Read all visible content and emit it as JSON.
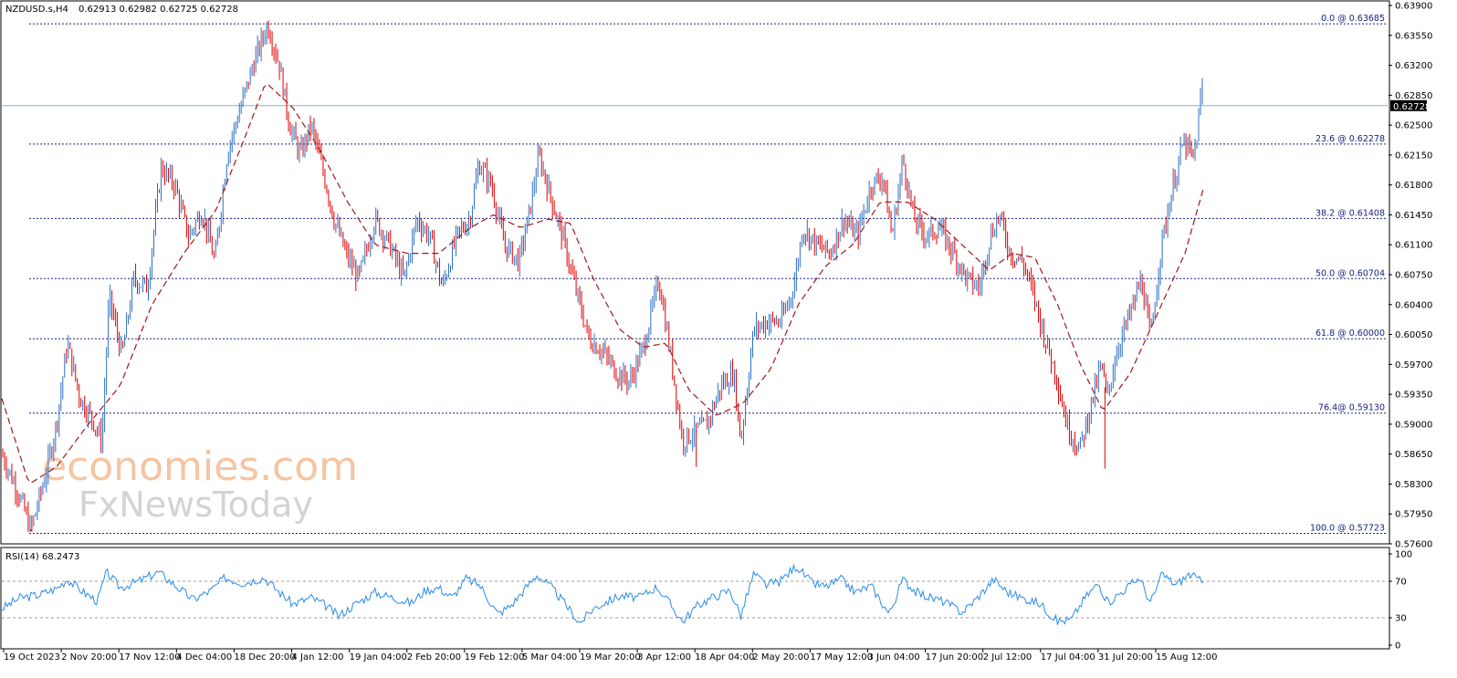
{
  "chart_data": [
    {
      "type": "candlestick",
      "header": {
        "symbol": "NZDUSD.s,H4",
        "ohlc": "0.62913 0.62982 0.62725 0.62728"
      },
      "price_axis": {
        "ticks": [
          "0.63900",
          "0.63550",
          "0.63200",
          "0.62850",
          "0.62500",
          "0.62150",
          "0.61800",
          "0.61450",
          "0.61100",
          "0.60750",
          "0.60400",
          "0.60050",
          "0.59700",
          "0.59350",
          "0.59000",
          "0.58650",
          "0.58300",
          "0.57950",
          "0.57600"
        ],
        "ylim": [
          0.576,
          0.639
        ],
        "current_price_label": "0.62728",
        "current_price": 0.62728
      },
      "time_axis": {
        "labels": [
          "19 Oct 2023",
          "2 Nov 20:00",
          "17 Nov 12:00",
          "4 Dec 04:00",
          "18 Dec 20:00",
          "4 Jan 12:00",
          "19 Jan 04:00",
          "2 Feb 20:00",
          "19 Feb 12:00",
          "5 Mar 04:00",
          "19 Mar 20:00",
          "3 Apr 12:00",
          "18 Apr 04:00",
          "2 May 20:00",
          "17 May 12:00",
          "3 Jun 04:00",
          "17 Jun 20:00",
          "2 Jul 12:00",
          "17 Jul 04:00",
          "31 Jul 20:00",
          "15 Aug 12:00"
        ]
      },
      "fibonacci_levels": [
        {
          "label": "0.0 @ 0.63685",
          "price": 0.63685
        },
        {
          "label": "23.6 @ 0.62278",
          "price": 0.62278
        },
        {
          "label": "38.2 @ 0.61408",
          "price": 0.61408
        },
        {
          "label": "50.0 @ 0.60704",
          "price": 0.60704
        },
        {
          "label": "61.8 @ 0.60000",
          "price": 0.6
        },
        {
          "label": "76.4@ 0.59130",
          "price": 0.5913
        },
        {
          "label": "100.0 @ 0.57723",
          "price": 0.57723
        }
      ],
      "price_path_approx": [
        [
          0,
          0.5865
        ],
        [
          18,
          0.582
        ],
        [
          32,
          0.5777
        ],
        [
          48,
          0.584
        ],
        [
          60,
          0.59
        ],
        [
          72,
          0.5995
        ],
        [
          86,
          0.593
        ],
        [
          100,
          0.5905
        ],
        [
          110,
          0.588
        ],
        [
          118,
          0.605
        ],
        [
          132,
          0.598
        ],
        [
          145,
          0.607
        ],
        [
          160,
          0.606
        ],
        [
          175,
          0.62
        ],
        [
          190,
          0.618
        ],
        [
          205,
          0.612
        ],
        [
          220,
          0.615
        ],
        [
          234,
          0.609
        ],
        [
          248,
          0.622
        ],
        [
          262,
          0.627
        ],
        [
          276,
          0.632
        ],
        [
          292,
          0.6368
        ],
        [
          305,
          0.632
        ],
        [
          316,
          0.625
        ],
        [
          328,
          0.6215
        ],
        [
          340,
          0.625
        ],
        [
          352,
          0.62
        ],
        [
          365,
          0.614
        ],
        [
          378,
          0.61
        ],
        [
          392,
          0.607
        ],
        [
          410,
          0.614
        ],
        [
          426,
          0.611
        ],
        [
          442,
          0.607
        ],
        [
          456,
          0.614
        ],
        [
          470,
          0.612
        ],
        [
          484,
          0.606
        ],
        [
          500,
          0.612
        ],
        [
          514,
          0.614
        ],
        [
          524,
          0.6205
        ],
        [
          538,
          0.618
        ],
        [
          552,
          0.611
        ],
        [
          568,
          0.609
        ],
        [
          580,
          0.615
        ],
        [
          590,
          0.6215
        ],
        [
          602,
          0.617
        ],
        [
          616,
          0.612
        ],
        [
          630,
          0.606
        ],
        [
          645,
          0.6
        ],
        [
          660,
          0.5985
        ],
        [
          676,
          0.596
        ],
        [
          690,
          0.595
        ],
        [
          705,
          0.599
        ],
        [
          722,
          0.607
        ],
        [
          735,
          0.598
        ],
        [
          748,
          0.588
        ],
        [
          760,
          0.589
        ],
        [
          775,
          0.59
        ],
        [
          790,
          0.5945
        ],
        [
          804,
          0.596
        ],
        [
          812,
          0.588
        ],
        [
          826,
          0.601
        ],
        [
          840,
          0.602
        ],
        [
          856,
          0.602
        ],
        [
          870,
          0.606
        ],
        [
          880,
          0.613
        ],
        [
          895,
          0.611
        ],
        [
          910,
          0.61
        ],
        [
          925,
          0.614
        ],
        [
          940,
          0.612
        ],
        [
          955,
          0.618
        ],
        [
          968,
          0.619
        ],
        [
          978,
          0.612
        ],
        [
          990,
          0.621
        ],
        [
          1002,
          0.614
        ],
        [
          1016,
          0.612
        ],
        [
          1030,
          0.613
        ],
        [
          1046,
          0.61
        ],
        [
          1060,
          0.607
        ],
        [
          1074,
          0.606
        ],
        [
          1086,
          0.612
        ],
        [
          1096,
          0.6145
        ],
        [
          1108,
          0.61
        ],
        [
          1122,
          0.609
        ],
        [
          1134,
          0.605
        ],
        [
          1146,
          0.6
        ],
        [
          1158,
          0.596
        ],
        [
          1170,
          0.59
        ],
        [
          1184,
          0.587
        ],
        [
          1196,
          0.592
        ],
        [
          1208,
          0.597
        ],
        [
          1214,
          0.593
        ],
        [
          1226,
          0.599
        ],
        [
          1240,
          0.603
        ],
        [
          1252,
          0.607
        ],
        [
          1262,
          0.6
        ],
        [
          1274,
          0.611
        ],
        [
          1286,
          0.6175
        ],
        [
          1298,
          0.623
        ],
        [
          1310,
          0.621
        ],
        [
          1319,
          0.6298
        ],
        [
          1320,
          0.62728
        ]
      ],
      "ma_path_approx": [
        [
          0,
          0.593
        ],
        [
          30,
          0.583
        ],
        [
          60,
          0.585
        ],
        [
          95,
          0.59
        ],
        [
          130,
          0.5945
        ],
        [
          165,
          0.604
        ],
        [
          200,
          0.61
        ],
        [
          235,
          0.615
        ],
        [
          265,
          0.623
        ],
        [
          290,
          0.63
        ],
        [
          320,
          0.627
        ],
        [
          350,
          0.622
        ],
        [
          380,
          0.616
        ],
        [
          410,
          0.611
        ],
        [
          445,
          0.61
        ],
        [
          480,
          0.61
        ],
        [
          515,
          0.613
        ],
        [
          540,
          0.6145
        ],
        [
          570,
          0.613
        ],
        [
          600,
          0.614
        ],
        [
          625,
          0.6135
        ],
        [
          650,
          0.607
        ],
        [
          680,
          0.601
        ],
        [
          705,
          0.599
        ],
        [
          730,
          0.5995
        ],
        [
          755,
          0.594
        ],
        [
          785,
          0.591
        ],
        [
          815,
          0.5925
        ],
        [
          845,
          0.5965
        ],
        [
          875,
          0.604
        ],
        [
          905,
          0.6085
        ],
        [
          935,
          0.611
        ],
        [
          965,
          0.616
        ],
        [
          995,
          0.616
        ],
        [
          1025,
          0.614
        ],
        [
          1055,
          0.611
        ],
        [
          1085,
          0.608
        ],
        [
          1110,
          0.61
        ],
        [
          1135,
          0.6095
        ],
        [
          1160,
          0.604
        ],
        [
          1185,
          0.597
        ],
        [
          1210,
          0.5915
        ],
        [
          1240,
          0.596
        ],
        [
          1270,
          0.603
        ],
        [
          1300,
          0.61
        ],
        [
          1320,
          0.6175
        ]
      ]
    },
    {
      "type": "line",
      "title": "RSI(14) 68.2473",
      "y_ticks": [
        "100",
        "70",
        "30",
        "0"
      ],
      "ylim": [
        0,
        100
      ],
      "guide_levels": [
        70,
        30
      ],
      "values_approx": [
        [
          0,
          40
        ],
        [
          20,
          52
        ],
        [
          40,
          55
        ],
        [
          60,
          62
        ],
        [
          72,
          72
        ],
        [
          90,
          58
        ],
        [
          105,
          48
        ],
        [
          115,
          80
        ],
        [
          130,
          63
        ],
        [
          150,
          70
        ],
        [
          172,
          80
        ],
        [
          190,
          66
        ],
        [
          210,
          50
        ],
        [
          230,
          60
        ],
        [
          245,
          74
        ],
        [
          265,
          68
        ],
        [
          288,
          74
        ],
        [
          305,
          58
        ],
        [
          320,
          45
        ],
        [
          340,
          52
        ],
        [
          355,
          44
        ],
        [
          370,
          32
        ],
        [
          390,
          46
        ],
        [
          410,
          58
        ],
        [
          430,
          52
        ],
        [
          450,
          46
        ],
        [
          465,
          60
        ],
        [
          480,
          63
        ],
        [
          495,
          52
        ],
        [
          510,
          73
        ],
        [
          525,
          66
        ],
        [
          545,
          34
        ],
        [
          560,
          44
        ],
        [
          575,
          62
        ],
        [
          588,
          77
        ],
        [
          605,
          62
        ],
        [
          620,
          44
        ],
        [
          635,
          24
        ],
        [
          650,
          40
        ],
        [
          665,
          48
        ],
        [
          680,
          54
        ],
        [
          700,
          52
        ],
        [
          720,
          64
        ],
        [
          735,
          44
        ],
        [
          748,
          26
        ],
        [
          765,
          44
        ],
        [
          780,
          52
        ],
        [
          800,
          60
        ],
        [
          812,
          32
        ],
        [
          826,
          78
        ],
        [
          840,
          66
        ],
        [
          855,
          70
        ],
        [
          873,
          87
        ],
        [
          890,
          68
        ],
        [
          905,
          64
        ],
        [
          922,
          72
        ],
        [
          938,
          58
        ],
        [
          955,
          65
        ],
        [
          975,
          34
        ],
        [
          990,
          72
        ],
        [
          1005,
          58
        ],
        [
          1020,
          52
        ],
        [
          1035,
          48
        ],
        [
          1055,
          36
        ],
        [
          1070,
          50
        ],
        [
          1090,
          72
        ],
        [
          1105,
          58
        ],
        [
          1120,
          52
        ],
        [
          1140,
          46
        ],
        [
          1160,
          26
        ],
        [
          1175,
          28
        ],
        [
          1190,
          52
        ],
        [
          1205,
          68
        ],
        [
          1215,
          46
        ],
        [
          1230,
          58
        ],
        [
          1250,
          74
        ],
        [
          1262,
          46
        ],
        [
          1275,
          78
        ],
        [
          1290,
          66
        ],
        [
          1305,
          78
        ],
        [
          1320,
          68.25
        ]
      ]
    }
  ],
  "watermark": {
    "line1": "economies.com",
    "line2": "FxNewsToday"
  },
  "colors": {
    "bull": "#2e6fc4",
    "bear": "#e00000",
    "ma": "#a01818",
    "fib": "#1a237e",
    "rsi": "#2a8be8",
    "price_line": "#7fb4d4"
  }
}
